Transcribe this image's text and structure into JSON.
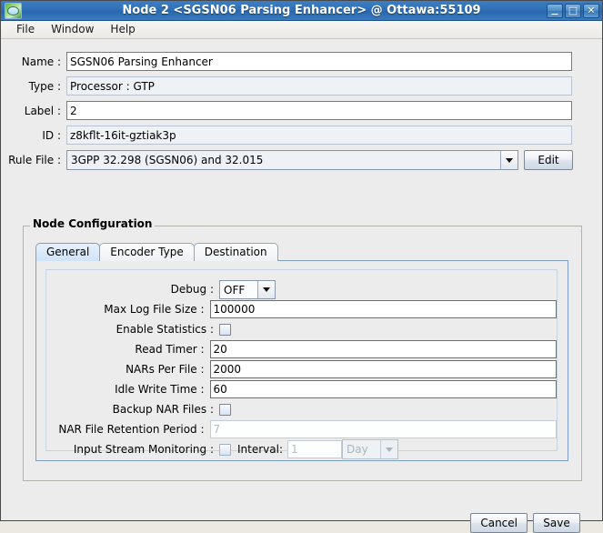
{
  "window": {
    "title": "Node 2 <SGSN06 Parsing Enhancer> @ Ottawa:55109",
    "app_icon": "node-app-icon",
    "controls": {
      "minimize": "minimize-icon",
      "maximize": "maximize-icon",
      "close": "close-icon"
    }
  },
  "menubar": {
    "items": [
      {
        "label": "File"
      },
      {
        "label": "Window"
      },
      {
        "label": "Help"
      }
    ]
  },
  "topform": {
    "name": {
      "label": "Name :",
      "value": "SGSN06 Parsing Enhancer"
    },
    "type": {
      "label": "Type :",
      "value": "Processor : GTP"
    },
    "node_label": {
      "label": "Label :",
      "value": "2"
    },
    "id": {
      "label": "ID :",
      "value": "z8kflt-16it-gztiak3p"
    },
    "rule_file": {
      "label": "Rule File :",
      "value": "3GPP 32.298 (SGSN06) and 32.015",
      "arrow_icon": "chevron-down-icon",
      "edit_label": "Edit"
    }
  },
  "node_configuration": {
    "title": "Node  Configuration",
    "tabs": [
      {
        "label": "General",
        "selected": true
      },
      {
        "label": "Encoder Type",
        "selected": false
      },
      {
        "label": "Destination",
        "selected": false
      }
    ],
    "general": {
      "debug": {
        "label": "Debug :",
        "value": "OFF",
        "arrow_icon": "chevron-down-icon"
      },
      "max_log_file_size": {
        "label": "Max Log File Size :",
        "value": "100000"
      },
      "enable_statistics": {
        "label": "Enable Statistics :",
        "checked": false
      },
      "read_timer": {
        "label": "Read Timer :",
        "value": "20"
      },
      "nars_per_file": {
        "label": "NARs Per File :",
        "value": "2000"
      },
      "idle_write_time": {
        "label": "Idle Write Time :",
        "value": "60"
      },
      "backup_nar_files": {
        "label": "Backup NAR Files :",
        "checked": false
      },
      "nar_file_retention_period": {
        "label": "NAR File Retention Period :",
        "value": "7",
        "disabled": true
      },
      "input_stream_monitoring": {
        "label": "Input Stream Monitoring :",
        "checked": false,
        "interval_label": "Interval:",
        "interval_value": "1",
        "unit_value": "Day",
        "unit_arrow_icon": "chevron-down-icon",
        "disabled": true
      }
    }
  },
  "footer": {
    "cancel_label": "Cancel",
    "save_label": "Save"
  }
}
